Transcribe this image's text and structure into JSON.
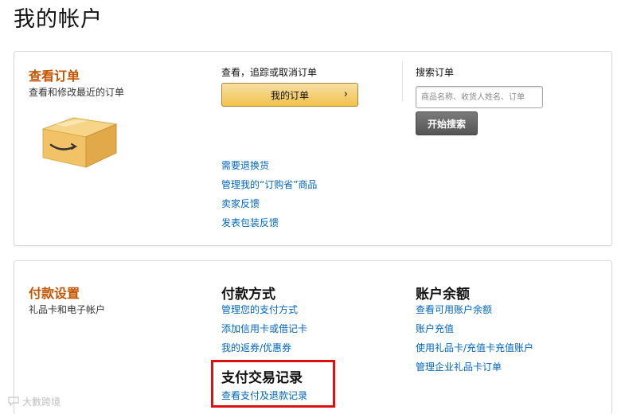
{
  "page": {
    "title": "我的帐户"
  },
  "orders": {
    "heading": "查看订单",
    "subtitle": "查看和修改最近的订单",
    "action_label": "查看，追踪或取消订单",
    "my_orders_button": "我的订单",
    "button_chevron": "›",
    "links": [
      "需要退换货",
      "管理我的“订购省”商品",
      "卖家反馈",
      "发表包装反馈"
    ],
    "search": {
      "label": "搜索订单",
      "placeholder": "商品名称、收货人姓名、订单",
      "button": "开始搜索"
    }
  },
  "payments": {
    "heading": "付款设置",
    "subtitle": "礼品卡和电子帐户",
    "methods": {
      "title": "付款方式",
      "links": [
        "管理您的支付方式",
        "添加信用卡或借记卡",
        "我的返券/优惠券"
      ]
    },
    "transactions": {
      "title": "支付交易记录",
      "links": [
        "查看支付及退款记录"
      ]
    },
    "balance": {
      "title": "账户余额",
      "links": [
        "查看可用账户余额",
        "账户充值",
        "使用礼品卡/充值卡充值账户",
        "管理企业礼品卡订单"
      ]
    }
  },
  "watermark": {
    "text": "大數跨境"
  },
  "colors": {
    "section_heading": "#c45500",
    "link": "#0066c0",
    "highlight": "#e01010"
  }
}
